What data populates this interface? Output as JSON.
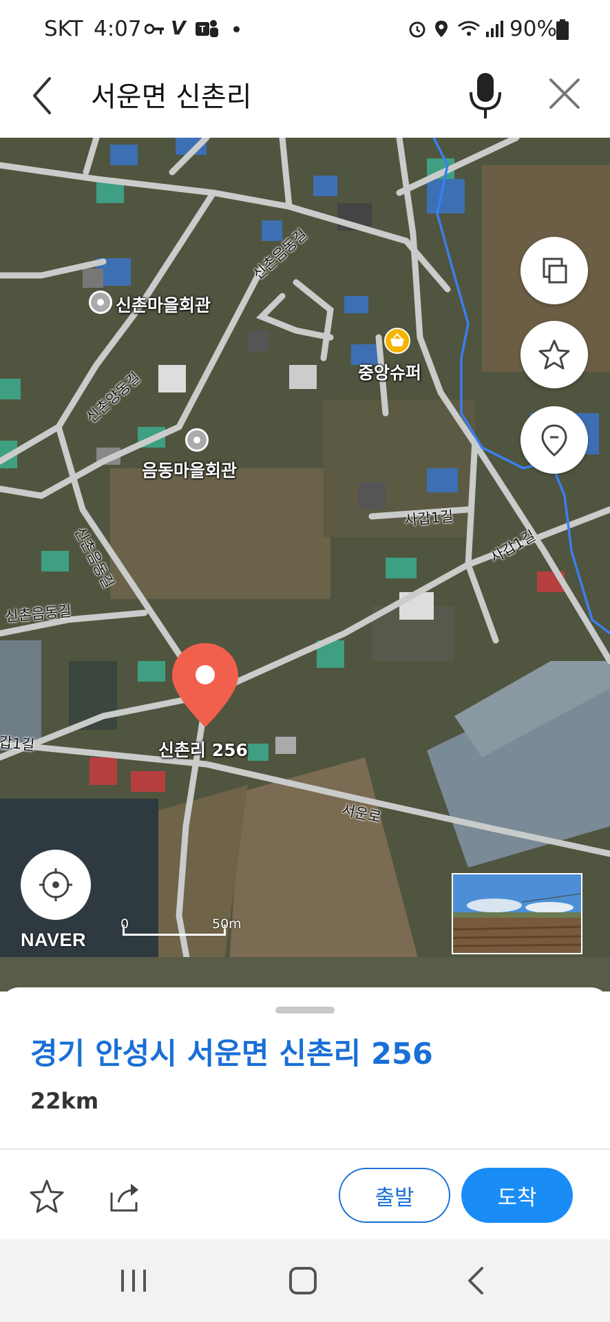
{
  "status_bar": {
    "carrier": "SKT",
    "time": "4:07",
    "battery": "90%"
  },
  "search": {
    "query": "서운면 신촌리"
  },
  "map": {
    "places": [
      {
        "name": "신촌마을회관",
        "icon": "community-hall-icon"
      },
      {
        "name": "음동마을회관",
        "icon": "community-hall-icon"
      },
      {
        "name": "중앙슈퍼",
        "icon": "shopping-basket-icon"
      }
    ],
    "roads": [
      "신촌음동길",
      "신촌양동길",
      "신촌음동길",
      "신촌음동길",
      "사갑1길",
      "사갑1길",
      "갑1길",
      "서운로"
    ],
    "pin_label": "신촌리 256",
    "brand": "NAVER",
    "scale": {
      "zero": "0",
      "end": "50m"
    }
  },
  "place": {
    "address": "경기 안성시 서운면 신촌리 256",
    "distance": "22km",
    "depart_label": "출발",
    "arrive_label": "도착"
  },
  "colors": {
    "accent": "#1a8cf6",
    "pin": "#f0604d",
    "link": "#1a6fd6"
  }
}
